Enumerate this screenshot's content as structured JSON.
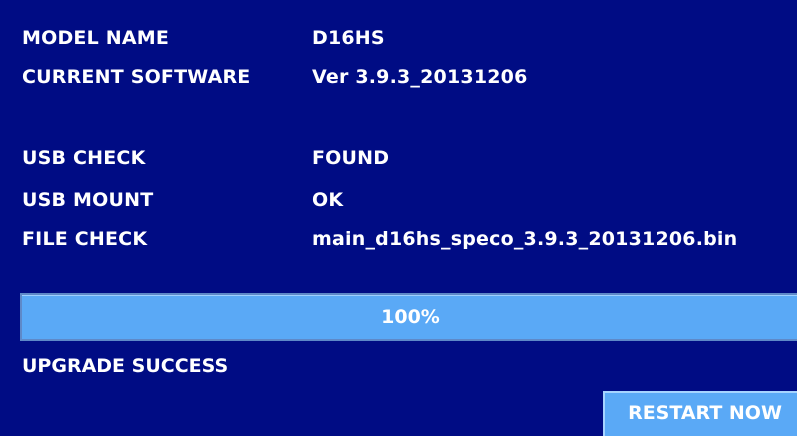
{
  "info": {
    "model_name_label": "MODEL NAME",
    "model_name_value": "D16HS",
    "software_label": "CURRENT SOFTWARE",
    "software_value": "Ver 3.9.3_20131206",
    "usb_check_label": "USB CHECK",
    "usb_check_value": "FOUND",
    "usb_mount_label": "USB MOUNT",
    "usb_mount_value": "OK",
    "file_check_label": "FILE CHECK",
    "file_check_value": "main_d16hs_speco_3.9.3_20131206.bin"
  },
  "progress": {
    "text": "100%",
    "fraction": 1.0
  },
  "status": {
    "text": "UPGRADE SUCCESS"
  },
  "actions": {
    "restart_label": "RESTART NOW"
  },
  "colors": {
    "background": "#000c84",
    "progress_fill": "#5aa9f6",
    "button": "#5aa9f6",
    "text": "#ffffff"
  }
}
